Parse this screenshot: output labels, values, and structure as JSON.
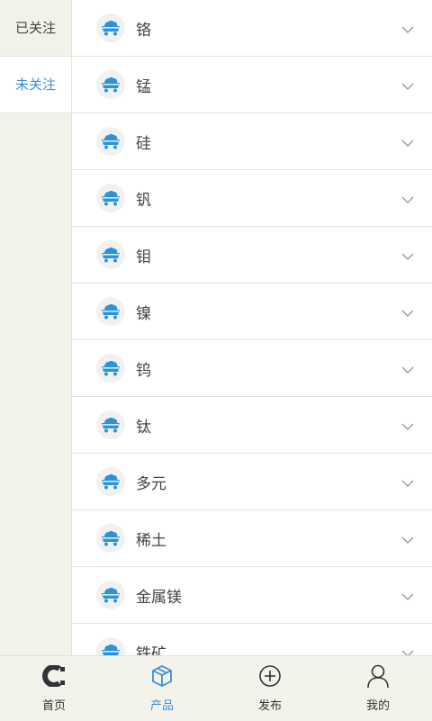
{
  "sidebar": {
    "tabs": [
      {
        "label": "已关注",
        "active": false
      },
      {
        "label": "未关注",
        "active": true
      }
    ]
  },
  "list": {
    "items": [
      {
        "label": "铬"
      },
      {
        "label": "锰"
      },
      {
        "label": "硅"
      },
      {
        "label": "钒"
      },
      {
        "label": "钼"
      },
      {
        "label": "镍"
      },
      {
        "label": "钨"
      },
      {
        "label": "钛"
      },
      {
        "label": "多元"
      },
      {
        "label": "稀土"
      },
      {
        "label": "金属镁"
      },
      {
        "label": "铁矿"
      }
    ],
    "item_icon": "mining-cart-icon",
    "expand_icon": "chevron-down-icon"
  },
  "tabbar": {
    "items": [
      {
        "label": "首页",
        "icon": "home-logo-icon"
      },
      {
        "label": "产品",
        "icon": "cube-icon"
      },
      {
        "label": "发布",
        "icon": "add-circle-icon"
      },
      {
        "label": "我的",
        "icon": "user-icon"
      }
    ]
  },
  "colors": {
    "accent": "#3a8fd6",
    "icon_blue": "#2b93d8",
    "background": "#f2f2ea"
  }
}
